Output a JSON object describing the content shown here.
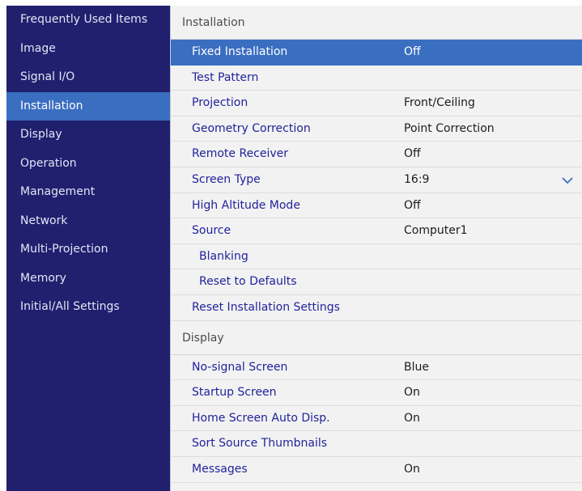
{
  "sidebar": {
    "items": [
      {
        "label": "Frequently Used Items"
      },
      {
        "label": "Image"
      },
      {
        "label": "Signal I/O"
      },
      {
        "label": "Installation"
      },
      {
        "label": "Display"
      },
      {
        "label": "Operation"
      },
      {
        "label": "Management"
      },
      {
        "label": "Network"
      },
      {
        "label": "Multi-Projection"
      },
      {
        "label": "Memory"
      },
      {
        "label": "Initial/All Settings"
      }
    ],
    "active_index": 3
  },
  "installation": {
    "title": "Installation",
    "rows": [
      {
        "label": "Fixed Installation",
        "value": "Off"
      },
      {
        "label": "Test Pattern",
        "value": ""
      },
      {
        "label": "Projection",
        "value": "Front/Ceiling"
      },
      {
        "label": "Geometry Correction",
        "value": "Point Correction"
      },
      {
        "label": "Remote Receiver",
        "value": "Off"
      },
      {
        "label": "Screen Type",
        "value": "16:9",
        "icon": "chevron-down-icon"
      },
      {
        "label": "High Altitude Mode",
        "value": "Off"
      },
      {
        "label": "Source",
        "value": "Computer1"
      },
      {
        "label": "Blanking",
        "value": ""
      },
      {
        "label": "Reset to Defaults",
        "value": ""
      },
      {
        "label": "Reset Installation Settings",
        "value": ""
      }
    ]
  },
  "display": {
    "title": "Display",
    "rows": [
      {
        "label": "No-signal Screen",
        "value": "Blue"
      },
      {
        "label": "Startup Screen",
        "value": "On"
      },
      {
        "label": "Home Screen Auto Disp.",
        "value": "On"
      },
      {
        "label": "Sort Source Thumbnails",
        "value": ""
      },
      {
        "label": "Messages",
        "value": "On"
      }
    ]
  },
  "colors": {
    "sidebar_bg": "#20206f",
    "highlight": "#3a6ec1",
    "panel_bg": "#f2f2f2",
    "label_text": "#22229c"
  }
}
